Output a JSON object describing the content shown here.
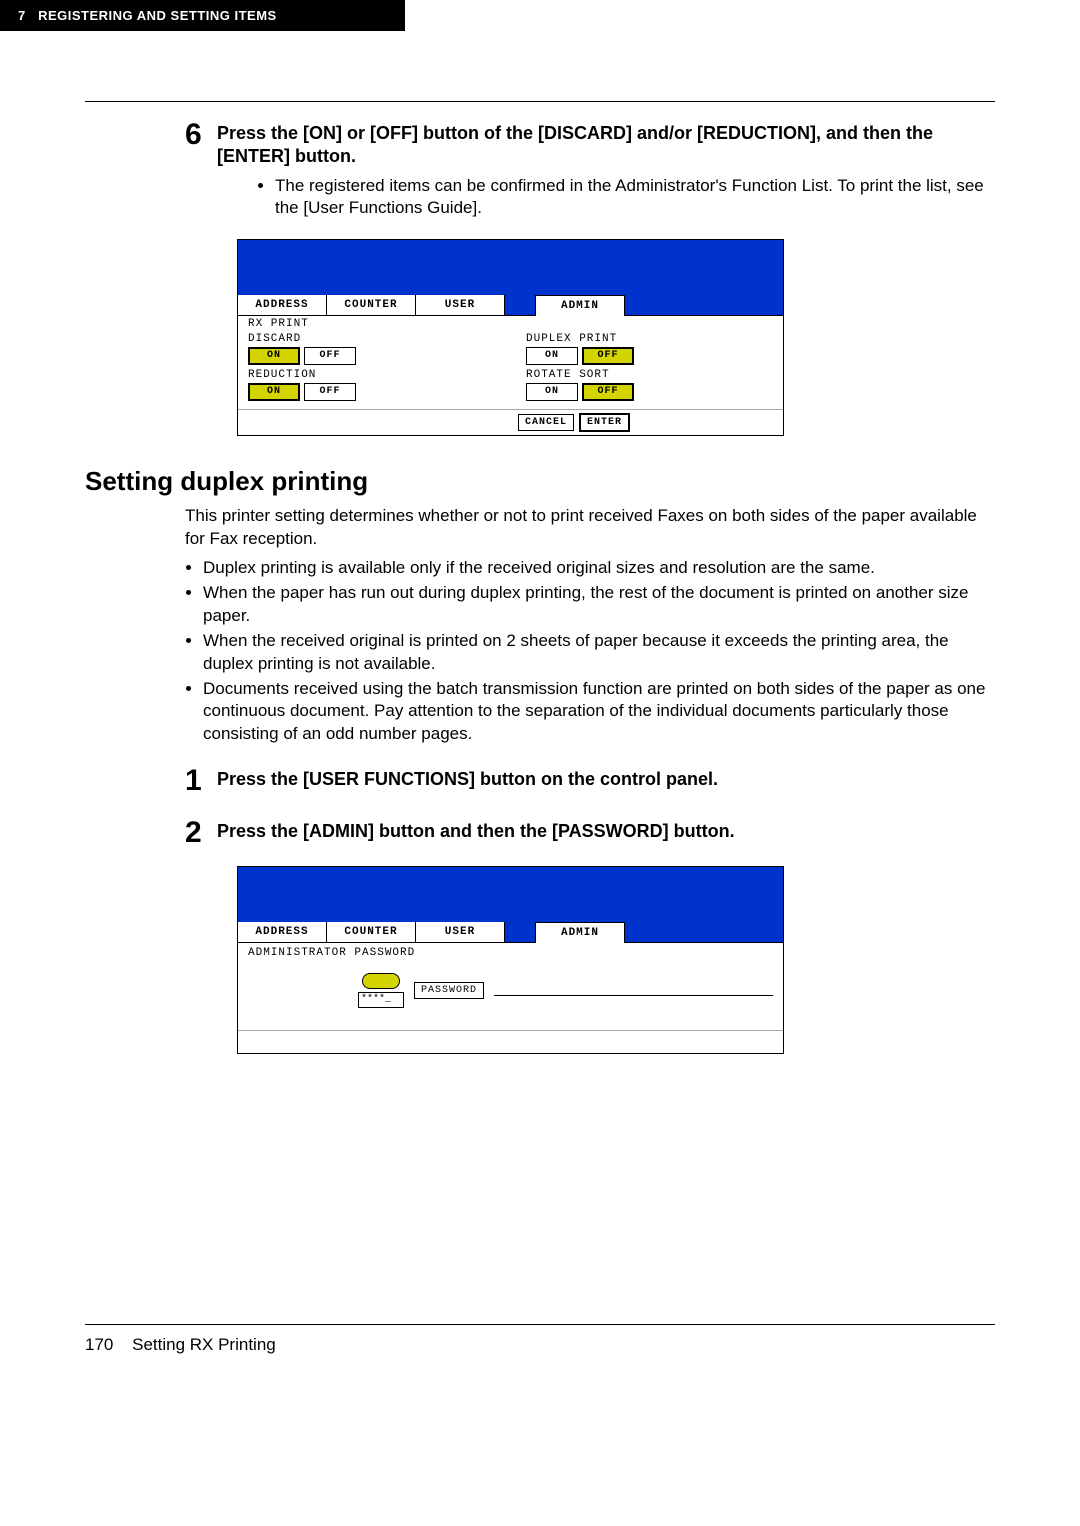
{
  "header": {
    "chapter_num": "7",
    "chapter_title": "REGISTERING AND SETTING ITEMS"
  },
  "step6": {
    "num": "6",
    "title": "Press the [ON] or [OFF] button of the [DISCARD] and/or [REDUCTION], and then the [ENTER] button.",
    "bullet1": "The registered items can be confirmed in the Administrator's Function List. To print the list, see the [User Functions Guide]."
  },
  "screenshot1": {
    "tabs": {
      "address": "ADDRESS",
      "counter": "COUNTER",
      "user": "USER",
      "admin": "ADMIN"
    },
    "title": "RX PRINT",
    "discard": "DISCARD",
    "reduction": "REDUCTION",
    "duplex_print": "DUPLEX PRINT",
    "rotate_sort": "ROTATE SORT",
    "on": "ON",
    "off": "OFF",
    "cancel": "CANCEL",
    "enter": "ENTER"
  },
  "section": {
    "heading": "Setting duplex printing",
    "intro": "This printer setting determines whether or not to print received Faxes on both sides of the paper available for Fax reception.",
    "b1": "Duplex printing is available only if the received original sizes and resolution are the same.",
    "b2": "When the paper has run out during duplex printing, the rest of the document is printed on another size paper.",
    "b3": "When the received original is printed on 2 sheets of paper because it exceeds the printing area, the duplex printing is not available.",
    "b4": "Documents received using the batch transmission function are printed on both sides of the paper as one continuous document. Pay attention to the separation of the individual documents particularly those consisting of an odd number pages."
  },
  "step1": {
    "num": "1",
    "title": "Press the [USER FUNCTIONS] button on the control panel."
  },
  "step2": {
    "num": "2",
    "title": "Press the [ADMIN] button and then the [PASSWORD] button."
  },
  "screenshot2": {
    "tabs": {
      "address": "ADDRESS",
      "counter": "COUNTER",
      "user": "USER",
      "admin": "ADMIN"
    },
    "title": "ADMINISTRATOR PASSWORD",
    "mask": "****_",
    "password": "PASSWORD"
  },
  "footer": {
    "page_num": "170",
    "section": "Setting RX Printing"
  }
}
